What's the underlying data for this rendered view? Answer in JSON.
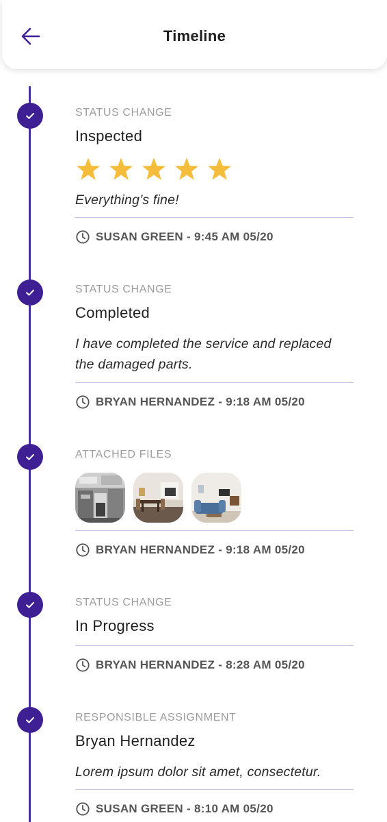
{
  "header": {
    "title": "Timeline",
    "back_icon": "arrow-left-icon",
    "accent_color": "#3f1f94"
  },
  "entries": [
    {
      "type_label": "STATUS CHANGE",
      "title": "Inspected",
      "rating": 5,
      "rating_max": 5,
      "note": "Everything’s fine!",
      "meta": "SUSAN GREEN - 9:45 AM 05/20"
    },
    {
      "type_label": "STATUS CHANGE",
      "title": "Completed",
      "note_line1": "I have completed the service and replaced",
      "note_line2": "the damaged parts.",
      "meta": "BRYAN HERNANDEZ - 9:18 AM 05/20"
    },
    {
      "type_label": "ATTACHED FILES",
      "files": [
        "kitchen-photo",
        "dining-room-photo",
        "living-room-photo"
      ],
      "meta": "BRYAN HERNANDEZ - 9:18 AM 05/20"
    },
    {
      "type_label": "STATUS CHANGE",
      "title": "In Progress",
      "meta": "BRYAN HERNANDEZ - 8:28 AM 05/20"
    },
    {
      "type_label": "RESPONSIBLE ASSIGNMENT",
      "title": "Bryan Hernandez",
      "note": "Lorem ipsum dolor sit amet, consectetur.",
      "meta": "SUSAN GREEN - 8:10 AM 05/20"
    }
  ],
  "colors": {
    "timeline": "#3f1f94",
    "star": "#f5bd3c",
    "divider": "#c9c3e6"
  }
}
